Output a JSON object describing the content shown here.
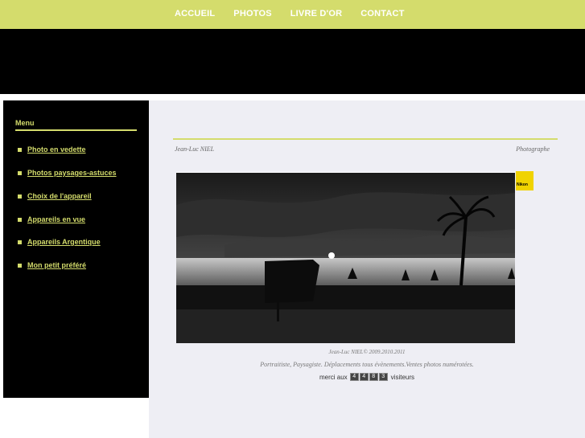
{
  "topnav": {
    "items": [
      "ACCUEIL",
      "PHOTOS",
      "LIVRE D'OR",
      "CONTACT"
    ]
  },
  "sidebar": {
    "title": "Menu",
    "items": [
      "Photo en vedette",
      "Photos paysages-astuces",
      "Choix de l'appareil",
      "Appareils en vue",
      "Appareils Argentique",
      "Mon petit préféré"
    ]
  },
  "content": {
    "author": "Jean-Luc NIEL",
    "role": "Photographe",
    "brand_badge": "Nikon",
    "copyright": "Jean-Luc NIEL© 2009.2010.2011",
    "tagline": "Portraitiste, Paysagiste. Déplacements tous évènements.Ventes photos numérotées.",
    "counter_prefix": "merci aux",
    "counter_digits": [
      "4",
      "4",
      "8",
      "3"
    ],
    "counter_suffix": "visiteurs"
  },
  "colors": {
    "accent": "#d4dc6c",
    "background_dark": "#000000",
    "content_bg": "#eeeef4"
  }
}
